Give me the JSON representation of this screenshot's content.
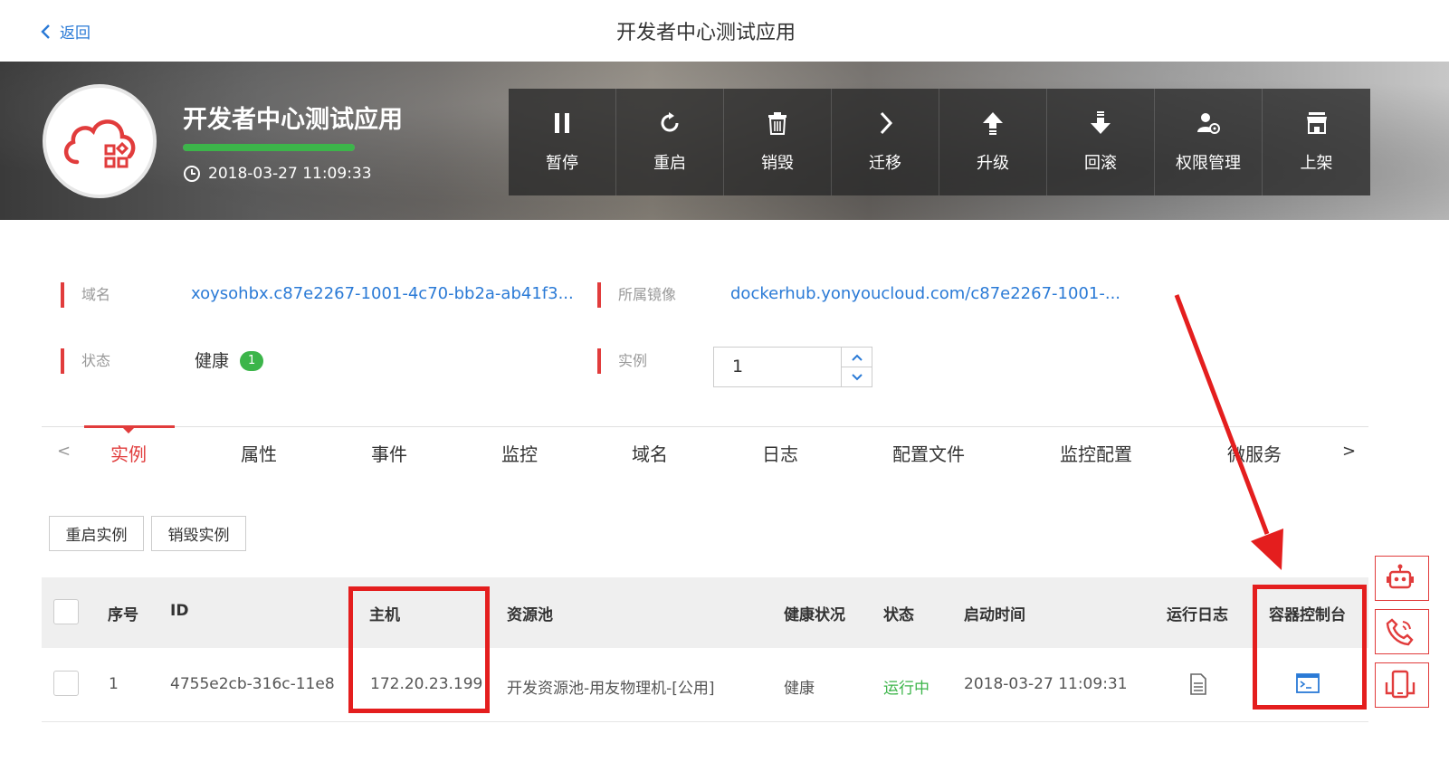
{
  "topnav": {
    "back_label": "返回",
    "title": "开发者中心测试应用"
  },
  "banner": {
    "app_name": "开发者中心测试应用",
    "created_at": "2018-03-27 11:09:33",
    "progress_fraction": 1.0,
    "actions": [
      {
        "label": "暂停",
        "icon": "pause-icon"
      },
      {
        "label": "重启",
        "icon": "restart-icon"
      },
      {
        "label": "销毁",
        "icon": "trash-icon"
      },
      {
        "label": "迁移",
        "icon": "chevron-right-icon"
      },
      {
        "label": "升级",
        "icon": "upgrade-icon"
      },
      {
        "label": "回滚",
        "icon": "rollback-icon"
      },
      {
        "label": "权限管理",
        "icon": "user-settings-icon"
      },
      {
        "label": "上架",
        "icon": "store-icon"
      }
    ]
  },
  "info": {
    "domain_label": "域名",
    "domain_value": "xoysohbx.c87e2267-1001-4c70-bb2a-ab41f3...",
    "image_label": "所属镜像",
    "image_value": "dockerhub.yonyoucloud.com/c87e2267-1001-...",
    "status_label": "状态",
    "status_value": "健康",
    "status_badge": "1",
    "instances_label": "实例",
    "instances_value": "1"
  },
  "tabs": {
    "prev": "<",
    "next": ">",
    "items": [
      "实例",
      "属性",
      "事件",
      "监控",
      "域名",
      "日志",
      "配置文件",
      "监控配置",
      "微服务"
    ],
    "active": "实例"
  },
  "buttons": {
    "restart_instance": "重启实例",
    "destroy_instance": "销毁实例"
  },
  "table": {
    "headers": {
      "index": "序号",
      "id": "ID",
      "host": "主机",
      "pool": "资源池",
      "health": "健康状况",
      "status": "状态",
      "started": "启动时间",
      "log": "运行日志",
      "console": "容器控制台"
    },
    "rows": [
      {
        "index": "1",
        "id": "4755e2cb-316c-11e8",
        "host": "172.20.23.199",
        "pool": "开发资源池-用友物理机-[公用]",
        "health": "健康",
        "status": "运行中",
        "started": "2018-03-27 11:09:31"
      }
    ]
  },
  "colors": {
    "accent_red": "#e13c3c",
    "link_blue": "#2a7ad6",
    "success_green": "#3cb54a",
    "annotation_red": "#e41e1e"
  }
}
